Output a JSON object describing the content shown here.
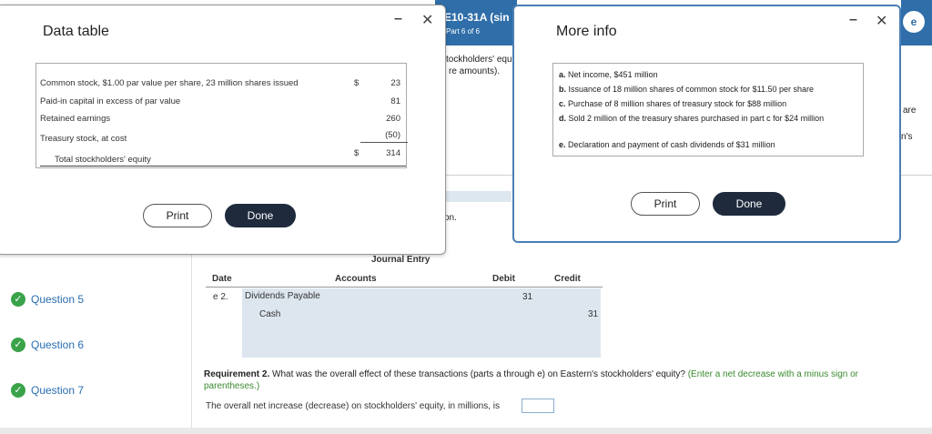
{
  "background": {
    "header_title": "E10-31A (sin",
    "header_sub": "Part 6 of 6",
    "header_right_badge": "e",
    "frag_equity": "tockholders' equ",
    "frag_amounts": "re amounts).",
    "frag_on": "on.",
    "frag_are": "are",
    "frag_ns": "n's"
  },
  "sidebar": {
    "questions": [
      {
        "label": "Question 5"
      },
      {
        "label": "Question 6"
      },
      {
        "label": "Question 7"
      }
    ]
  },
  "journal": {
    "title": "Journal Entry",
    "headers": {
      "date": "Date",
      "accounts": "Accounts",
      "debit": "Debit",
      "credit": "Credit"
    },
    "entry_label": "e 2.",
    "rows": [
      {
        "account": "Dividends Payable",
        "debit": "31",
        "credit": ""
      },
      {
        "account": "Cash",
        "debit": "",
        "credit": "31"
      }
    ]
  },
  "requirement": {
    "label": "Requirement 2.",
    "question": "What was the overall effect of these transactions (parts a through e) on Eastern's stockholders' equity?",
    "hint": "(Enter a net decrease with a minus sign or parentheses.)",
    "answer_prompt": "The overall net increase (decrease) on stockholders' equity, in millions, is"
  },
  "data_table_dialog": {
    "title": "Data table",
    "rows": [
      {
        "label": "Common stock, $1.00 par value per share, 23 million shares issued",
        "dollar": "$",
        "value": "23"
      },
      {
        "label": "Paid-in capital in excess of par value",
        "dollar": "",
        "value": "81"
      },
      {
        "label": "Retained earnings",
        "dollar": "",
        "value": "260"
      },
      {
        "label": "Treasury stock, at cost",
        "dollar": "",
        "value": "(50)"
      },
      {
        "label": "Total stockholders' equity",
        "dollar": "$",
        "value": "314"
      }
    ],
    "print_label": "Print",
    "done_label": "Done"
  },
  "more_info_dialog": {
    "title": "More info",
    "items": [
      {
        "letter": "a.",
        "text": "Net income, $451 million"
      },
      {
        "letter": "b.",
        "text": "Issuance of 18 million shares of common stock for $11.50 per share"
      },
      {
        "letter": "c.",
        "text": "Purchase of 8 million shares of treasury stock for $88 million"
      },
      {
        "letter": "d.",
        "text": "Sold 2 million of the treasury shares purchased in part c for $24 million"
      },
      {
        "letter": "e.",
        "text": "Declaration and payment of cash dividends of $31 million"
      }
    ],
    "print_label": "Print",
    "done_label": "Done"
  },
  "window_controls": {
    "minimize": "–",
    "close": "✕"
  },
  "icons": {
    "check": "✓"
  },
  "colors": {
    "header_blue": "#2f6ea8",
    "check_green": "#3aa34a",
    "link_blue": "#2a6db0",
    "done_dark": "#1f2b3d"
  }
}
